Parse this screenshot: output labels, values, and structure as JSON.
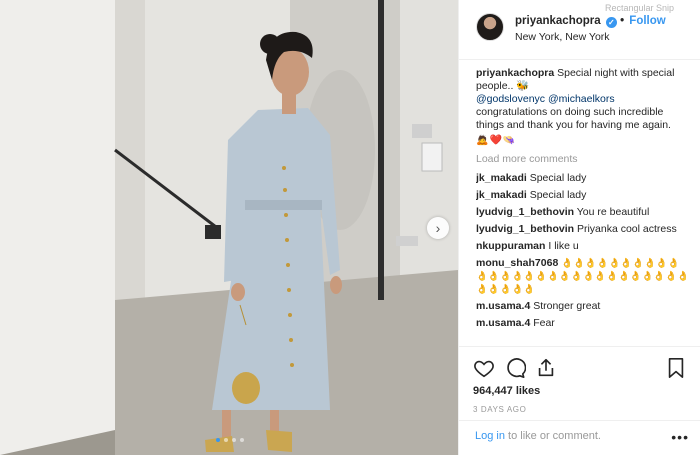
{
  "post": {
    "username": "priyankachopra",
    "verified_icon": "✓",
    "separator": "•",
    "follow_label": "Follow",
    "location": "New York, New York",
    "overlay_label": "Rectangular Snip"
  },
  "caption": {
    "username": "priyankachopra",
    "text": "Special night with special people..",
    "emoji": "🐝",
    "mention_1": "@godslovenyc",
    "mention_2": "@michaelkors",
    "text_2": "congratulations on doing such incredible things and thank you for having me again.",
    "emoji_row": "🙇❤️👒"
  },
  "load_more_label": "Load more comments",
  "comments": [
    {
      "user": "jk_makadi",
      "text": "Special lady"
    },
    {
      "user": "jk_makadi",
      "text": "Special lady"
    },
    {
      "user": "lyudvig_1_bethovin",
      "text": "You re beautiful"
    },
    {
      "user": "lyudvig_1_bethovin",
      "text": "Priyanka cool actress"
    },
    {
      "user": "nkuppuraman",
      "text": "I like u"
    },
    {
      "user": "monu_shah7068",
      "text": "👌👌👌👌👌👌👌👌👌👌👌👌👌👌👌👌👌👌👌👌👌👌👌👌👌👌👌👌👌👌👌👌👌"
    },
    {
      "user": "m.usama.4",
      "text": "Stronger great"
    },
    {
      "user": "m.usama.4",
      "text": "Fear"
    }
  ],
  "actions": {
    "likes": "964,447 likes",
    "time": "3 DAYS AGO"
  },
  "footer": {
    "login_label": "Log in",
    "rest_label": "to like or comment.",
    "more_label": "•••"
  },
  "carousel": {
    "next_label": "›",
    "dot_count": 4,
    "active_index": 0
  },
  "colors": {
    "link_blue": "#3897f0",
    "dress": "#b9c7d3",
    "wall": "#e9e8e4"
  }
}
